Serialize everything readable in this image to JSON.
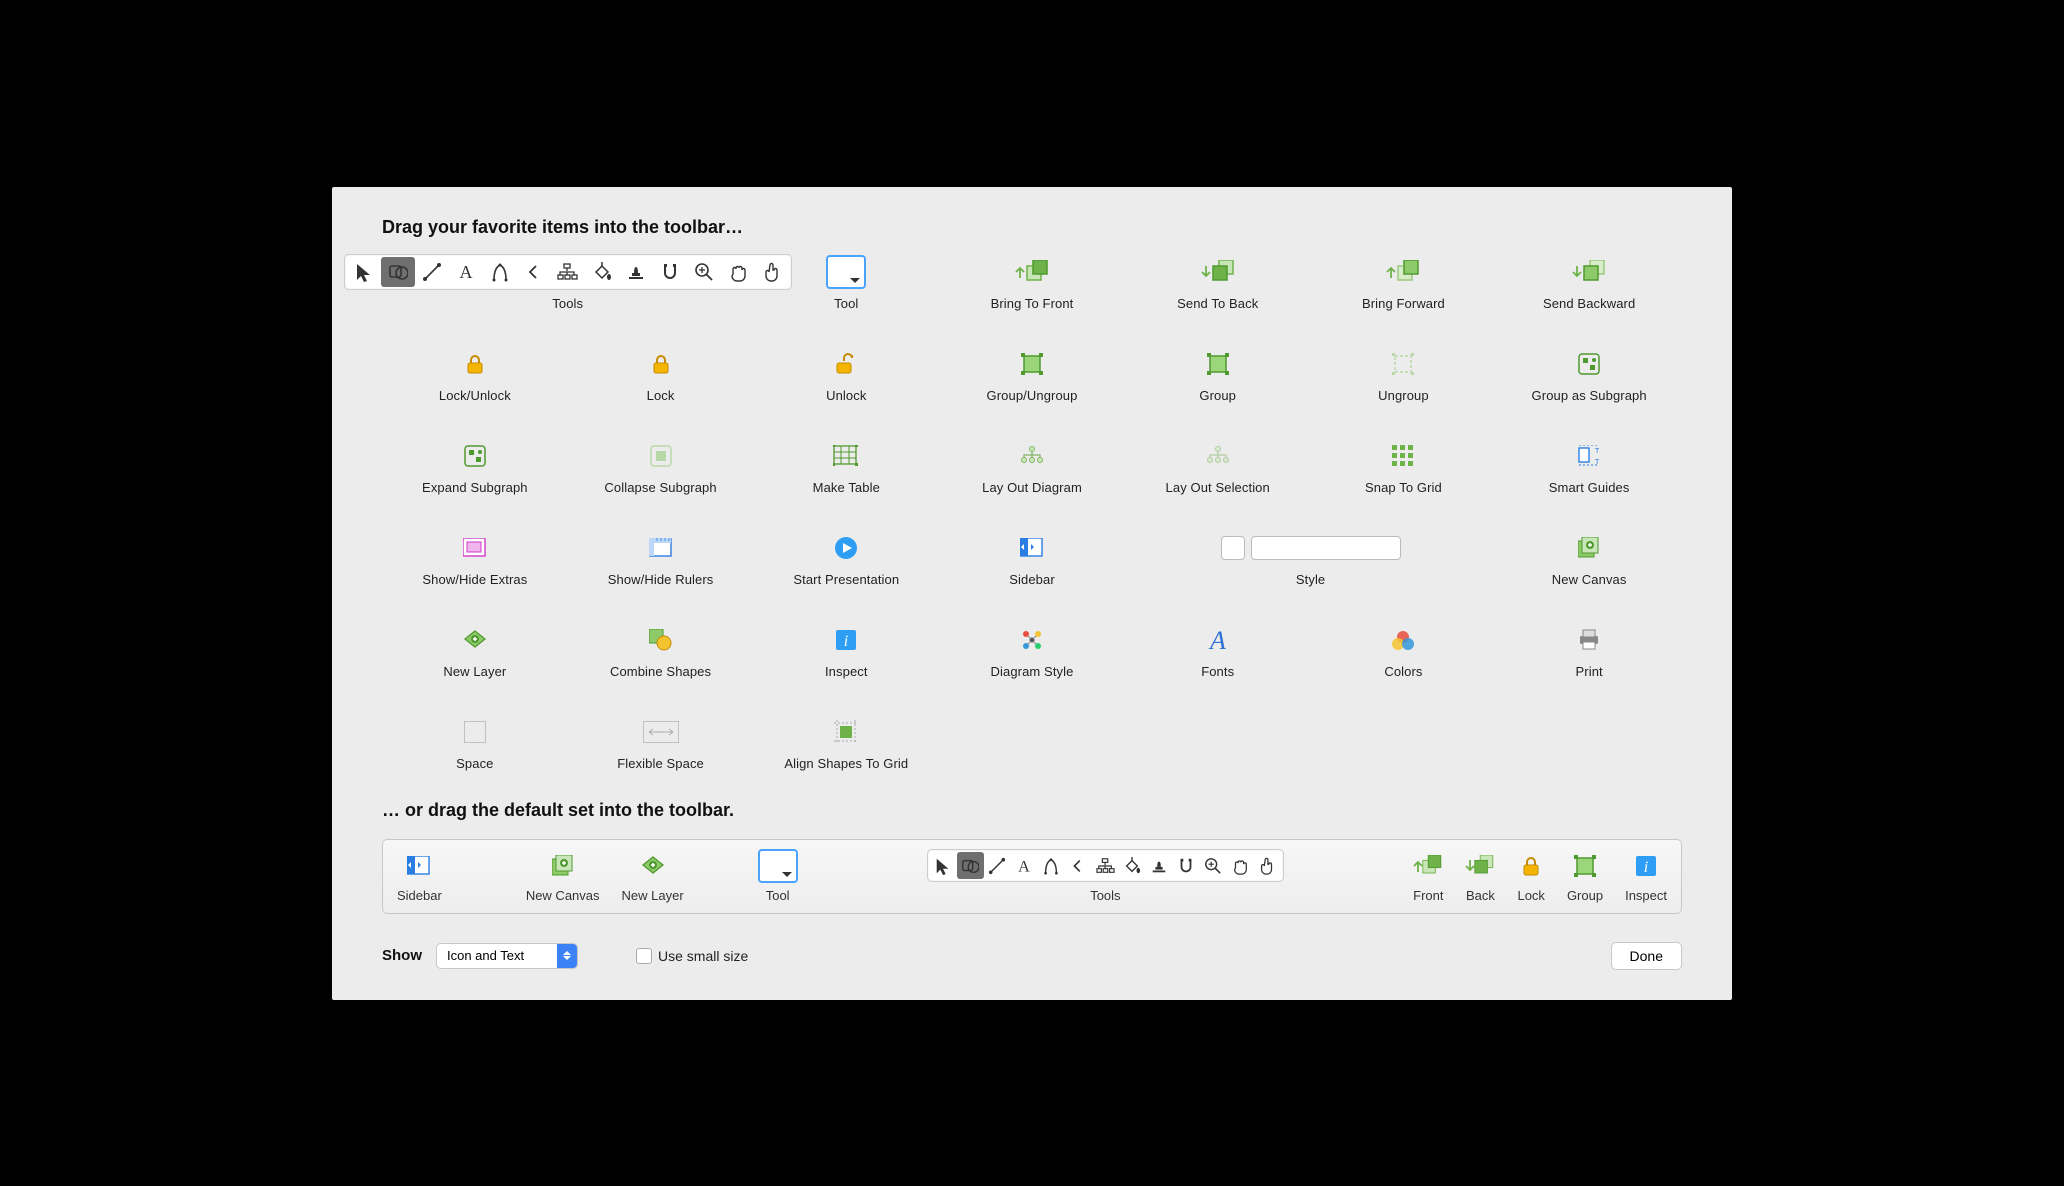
{
  "heading_main": "Drag your favorite items into the toolbar…",
  "heading_default": "… or drag the default set into the toolbar.",
  "items": {
    "tools": "Tools",
    "tool": "Tool",
    "bring_to_front": "Bring To Front",
    "send_to_back": "Send To Back",
    "bring_forward": "Bring Forward",
    "send_backward": "Send Backward",
    "lock_unlock": "Lock/Unlock",
    "lock": "Lock",
    "unlock": "Unlock",
    "group_ungroup": "Group/Ungroup",
    "group": "Group",
    "ungroup": "Ungroup",
    "group_as_subgraph": "Group as Subgraph",
    "expand_subgraph": "Expand Subgraph",
    "collapse_subgraph": "Collapse Subgraph",
    "make_table": "Make Table",
    "lay_out_diagram": "Lay Out Diagram",
    "lay_out_selection": "Lay Out Selection",
    "snap_to_grid": "Snap To Grid",
    "smart_guides": "Smart Guides",
    "show_hide_extras": "Show/Hide Extras",
    "show_hide_rulers": "Show/Hide Rulers",
    "start_presentation": "Start Presentation",
    "sidebar": "Sidebar",
    "style": "Style",
    "new_canvas": "New Canvas",
    "new_layer": "New Layer",
    "combine_shapes": "Combine Shapes",
    "inspect": "Inspect",
    "diagram_style": "Diagram Style",
    "fonts": "Fonts",
    "colors": "Colors",
    "print": "Print",
    "space": "Space",
    "flexible_space": "Flexible Space",
    "align_shapes_to_grid": "Align Shapes To Grid"
  },
  "default_bar": {
    "sidebar": "Sidebar",
    "new_canvas": "New Canvas",
    "new_layer": "New Layer",
    "tool": "Tool",
    "tools": "Tools",
    "front": "Front",
    "back": "Back",
    "lock": "Lock",
    "group": "Group",
    "inspect": "Inspect"
  },
  "footer": {
    "show_label": "Show",
    "show_value": "Icon and Text",
    "small_size": "Use small size",
    "done": "Done"
  }
}
